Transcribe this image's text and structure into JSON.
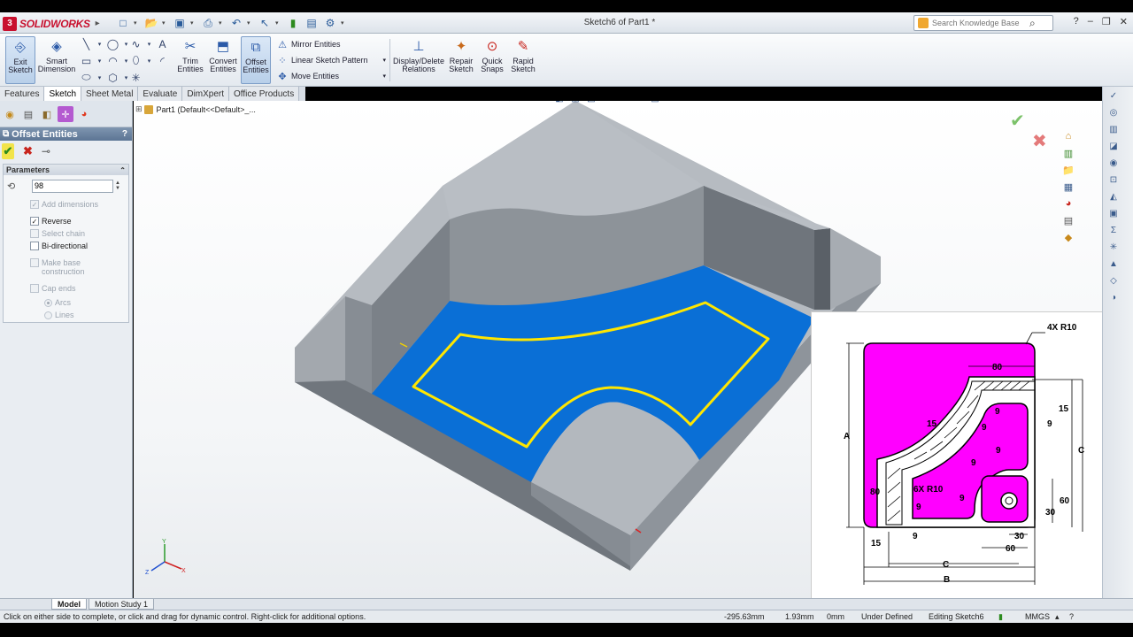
{
  "app": {
    "brand": "SOLIDWORKS",
    "document_title": "Sketch6 of Part1 *",
    "search_placeholder": "Search Knowledge Base"
  },
  "command_manager": {
    "exit_sketch": [
      "Exit",
      "Sketch"
    ],
    "smart_dimension": [
      "Smart",
      "Dimension"
    ],
    "trim_entities": [
      "Trim",
      "Entities"
    ],
    "convert_entities": [
      "Convert",
      "Entities"
    ],
    "offset_entities": [
      "Offset",
      "Entities"
    ],
    "mirror_entities": "Mirror Entities",
    "linear_sketch_pattern": "Linear Sketch Pattern",
    "move_entities": "Move Entities",
    "display_delete_relations": [
      "Display/Delete",
      "Relations"
    ],
    "repair_sketch": [
      "Repair",
      "Sketch"
    ],
    "quick_snaps": [
      "Quick",
      "Snaps"
    ],
    "rapid_sketch": [
      "Rapid",
      "Sketch"
    ]
  },
  "tabs": [
    "Features",
    "Sketch",
    "Sheet Metal",
    "Evaluate",
    "DimXpert",
    "Office Products"
  ],
  "active_tab": "Sketch",
  "property_manager": {
    "title": "Offset Entities",
    "help": "?",
    "parameters_label": "Parameters",
    "distance_value": "98",
    "options": {
      "add_dimensions": "Add dimensions",
      "reverse": "Reverse",
      "select_chain": "Select chain",
      "bi_directional": "Bi-directional",
      "make_base_construction": [
        "Make base",
        "construction"
      ],
      "cap_ends": "Cap ends",
      "arcs": "Arcs",
      "lines": "Lines"
    },
    "checked": {
      "add_dimensions": true,
      "reverse": true,
      "select_chain": false,
      "bi_directional": false,
      "make_base_construction": false,
      "cap_ends": false,
      "arcs": true,
      "lines": false
    }
  },
  "feature_tree": {
    "part": "Part1  (Default<<Default>_..."
  },
  "drawing": {
    "labels": {
      "corner_radius": "4X  R10",
      "top80": "80",
      "d15_right": "15",
      "d9_right": "9",
      "d15_arc": "15",
      "nine": "9",
      "A": "A",
      "C_right": "C",
      "d80_left": "80",
      "r10": "6X  R10",
      "d60_right": "60",
      "d30_right": "30",
      "d15_bottom": "15",
      "d30_bottom": "30",
      "d60_bottom": "60",
      "C_bottom": "C",
      "B_bottom": "B"
    }
  },
  "bottom_tabs": [
    "Model",
    "Motion Study 1"
  ],
  "status": {
    "hint": "Click on either side to complete, or click and drag for dynamic control.  Right-click for additional options.",
    "x": "-295.63mm",
    "y": "1.93mm",
    "z": "0mm",
    "definition": "Under Defined",
    "editing": "Editing Sketch6",
    "units": "MMGS"
  },
  "icons": {
    "exit_sketch": "exit-sketch-icon",
    "smart_dimension": "smart-dimension-icon",
    "offset": "offset-icon",
    "ok": "check-icon",
    "cancel": "close-icon",
    "pin": "pin-icon"
  },
  "colors": {
    "face_blue": "#0a6fd6",
    "sketch_yellow": "#ffe600",
    "drawing_magenta": "#ff00ff",
    "body_grey": "#9aa0a8"
  }
}
